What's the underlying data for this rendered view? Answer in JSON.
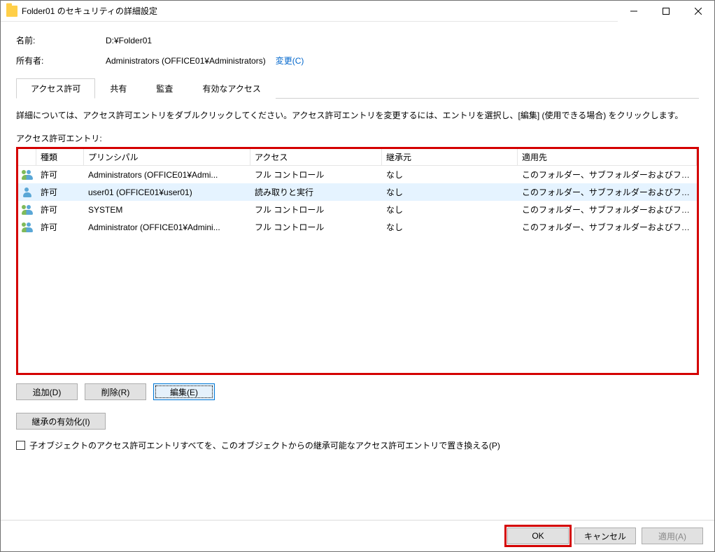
{
  "titlebar": {
    "title": "Folder01 のセキュリティの詳細設定"
  },
  "fields": {
    "name_label": "名前:",
    "name_value": "D:¥Folder01",
    "owner_label": "所有者:",
    "owner_value": "Administrators (OFFICE01¥Administrators)",
    "change_link": "変更(C)"
  },
  "tabs": {
    "permissions": "アクセス許可",
    "share": "共有",
    "audit": "監査",
    "effective": "有効なアクセス"
  },
  "description": "詳細については、アクセス許可エントリをダブルクリックしてください。アクセス許可エントリを変更するには、エントリを選択し、[編集] (使用できる場合) をクリックします。",
  "list_label": "アクセス許可エントリ:",
  "headers": {
    "type": "種類",
    "principal": "プリンシパル",
    "access": "アクセス",
    "inherit": "継承元",
    "apply": "適用先"
  },
  "rows": [
    {
      "icon": "group",
      "type": "許可",
      "principal": "Administrators (OFFICE01¥Admi...",
      "access": "フル コントロール",
      "inherit": "なし",
      "apply": "このフォルダー、サブフォルダーおよびファ..."
    },
    {
      "icon": "user",
      "type": "許可",
      "principal": "user01 (OFFICE01¥user01)",
      "access": "読み取りと実行",
      "inherit": "なし",
      "apply": "このフォルダー、サブフォルダーおよびファ..."
    },
    {
      "icon": "group",
      "type": "許可",
      "principal": "SYSTEM",
      "access": "フル コントロール",
      "inherit": "なし",
      "apply": "このフォルダー、サブフォルダーおよびファ..."
    },
    {
      "icon": "group",
      "type": "許可",
      "principal": "Administrator (OFFICE01¥Admini...",
      "access": "フル コントロール",
      "inherit": "なし",
      "apply": "このフォルダー、サブフォルダーおよびファ..."
    }
  ],
  "buttons": {
    "add": "追加(D)",
    "remove": "削除(R)",
    "edit": "編集(E)",
    "enable_inherit": "継承の有効化(I)"
  },
  "checkbox_label": "子オブジェクトのアクセス許可エントリすべてを、このオブジェクトからの継承可能なアクセス許可エントリで置き換える(P)",
  "footer": {
    "ok": "OK",
    "cancel": "キャンセル",
    "apply": "適用(A)"
  }
}
